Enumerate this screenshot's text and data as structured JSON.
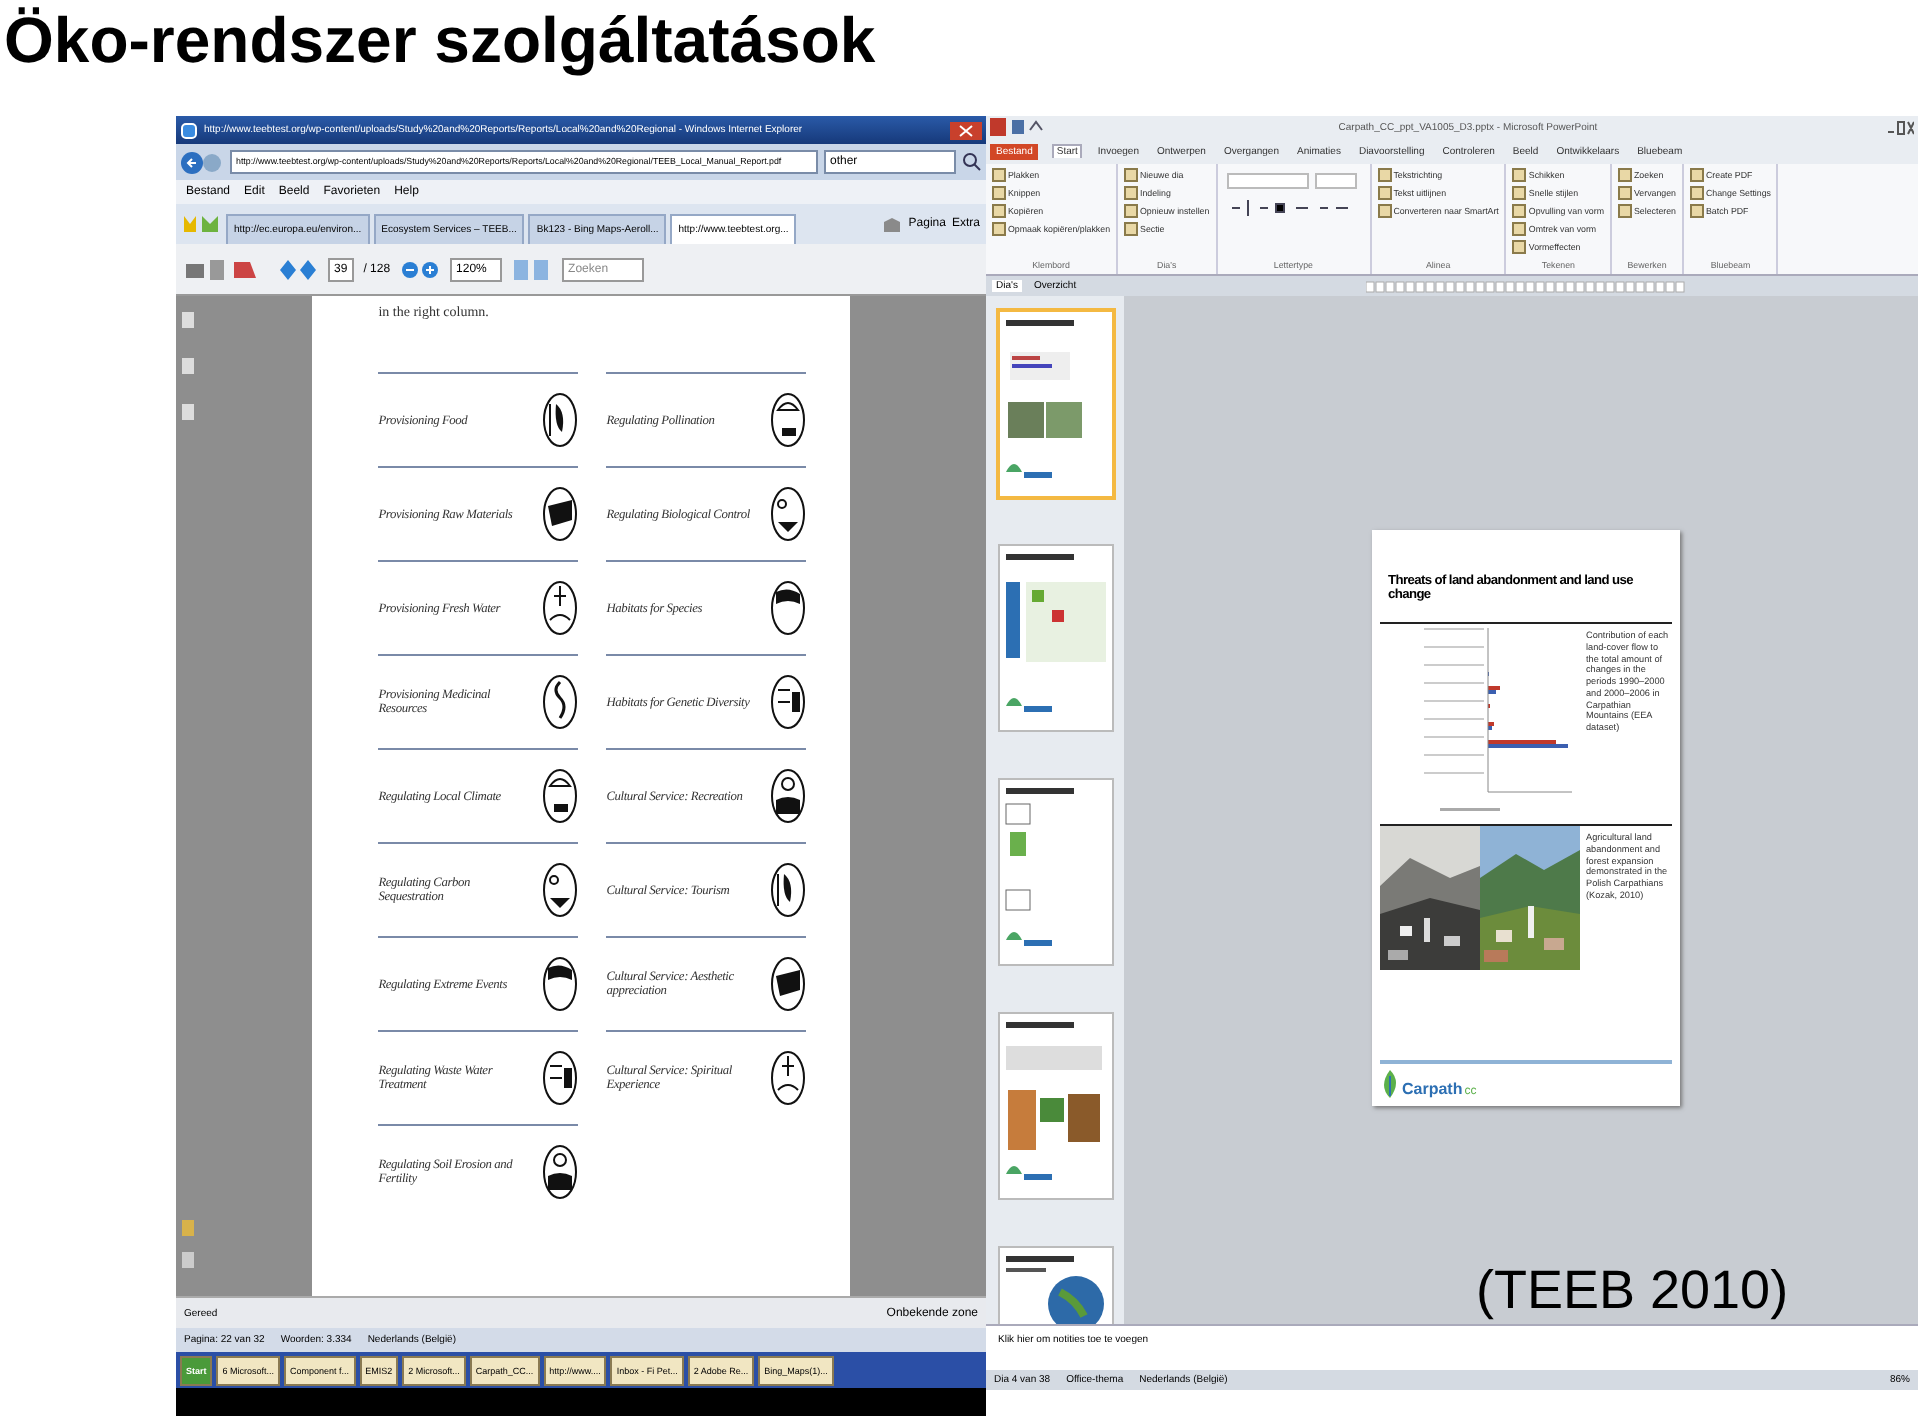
{
  "slide": {
    "title": "Öko-rendszer szolgáltatások",
    "caption": "(TEEB 2010)"
  },
  "browser": {
    "title": "http://www.teebtest.org/wp-content/uploads/Study%20and%20Reports/Reports/Local%20and%20Regional - Windows Internet Explorer",
    "address": "http://www.teebtest.org/wp-content/uploads/Study%20and%20Reports/Reports/Local%20and%20Regional/TEEB_Local_Manual_Report.pdf",
    "search": "other",
    "menu": [
      "Bestand",
      "Edit",
      "Beeld",
      "Favorieten",
      "Help"
    ],
    "tabs": [
      {
        "label": "http://ec.europa.eu/environ...",
        "selected": false
      },
      {
        "label": "Ecosystem Services – TEEB...",
        "selected": false
      },
      {
        "label": "Bk123 - Bing Maps-Aeroll...",
        "selected": false
      },
      {
        "label": "http://www.teebtest.org...",
        "selected": true
      }
    ],
    "toolbar_right": [
      "Pagina",
      "Extra"
    ],
    "page_number": "39",
    "page_count": "/ 128",
    "zoom": "120%",
    "find": "Zoeken",
    "document": {
      "intro": "in the right column.",
      "left": [
        "Provisioning Food",
        "Provisioning Raw Materials",
        "Provisioning Fresh Water",
        "Provisioning Medicinal Resources",
        "Regulating Local Climate",
        "Regulating Carbon Sequestration",
        "Regulating Extreme Events",
        "Regulating Waste Water Treatment",
        "Regulating Soil Erosion and Fertility"
      ],
      "right": [
        "Regulating Pollination",
        "Regulating Biological Control",
        "Habitats for Species",
        "Habitats for Genetic Diversity",
        "Cultural Service: Recreation",
        "Cultural Service: Tourism",
        "Cultural Service: Aesthetic appreciation",
        "Cultural Service: Spiritual Experience"
      ]
    },
    "status": "Gereed",
    "zone": "Onbekende zone",
    "word_status": [
      "Pagina: 22 van 32",
      "Woorden: 3.334",
      "Nederlands (België)"
    ],
    "taskbar": [
      "Start",
      "6 Microsoft...",
      "Component f...",
      "EMIS2",
      "2 Microsoft...",
      "Carpath_CC...",
      "http://www....",
      "Inbox - Fi Pet...",
      "2 Adobe Re...",
      "Bing_Maps(1)..."
    ]
  },
  "powerpoint": {
    "title": "Carpath_CC_ppt_VA1005_D3.pptx - Microsoft PowerPoint",
    "tabs": [
      {
        "label": "Bestand",
        "kind": "file",
        "selected": false
      },
      {
        "label": "Start",
        "kind": "tab",
        "selected": true
      },
      {
        "label": "Invoegen",
        "kind": "tab",
        "selected": false
      },
      {
        "label": "Ontwerpen",
        "kind": "tab",
        "selected": false
      },
      {
        "label": "Overgangen",
        "kind": "tab",
        "selected": false
      },
      {
        "label": "Animaties",
        "kind": "tab",
        "selected": false
      },
      {
        "label": "Diavoorstelling",
        "kind": "tab",
        "selected": false
      },
      {
        "label": "Controleren",
        "kind": "tab",
        "selected": false
      },
      {
        "label": "Beeld",
        "kind": "tab",
        "selected": false
      },
      {
        "label": "Ontwikkelaars",
        "kind": "tab",
        "selected": false
      },
      {
        "label": "Bluebeam",
        "kind": "tab",
        "selected": false
      }
    ],
    "groups": [
      {
        "label": "Klembord",
        "buttons": [
          "Plakken",
          "Knippen",
          "Kopiëren",
          "Opmaak kopiëren/plakken"
        ]
      },
      {
        "label": "Dia's",
        "buttons": [
          "Nieuwe dia",
          "Indeling",
          "Opnieuw instellen",
          "Sectie"
        ]
      },
      {
        "label": "Lettertype"
      },
      {
        "label": "Alinea",
        "buttons": [
          "Tekstrichting",
          "Tekst uitlijnen",
          "Converteren naar SmartArt"
        ]
      },
      {
        "label": "Tekenen",
        "buttons": [
          "Schikken",
          "Snelle stijlen",
          "Opvulling van vorm",
          "Omtrek van vorm",
          "Vormeffecten"
        ]
      },
      {
        "label": "Bewerken",
        "buttons": [
          "Zoeken",
          "Vervangen",
          "Selecteren"
        ]
      },
      {
        "label": "Bluebeam",
        "buttons": [
          "Create PDF",
          "Change Settings",
          "Batch PDF"
        ]
      }
    ],
    "panel_tabs": [
      {
        "label": "Dia's",
        "selected": true
      },
      {
        "label": "Overzicht",
        "selected": false
      }
    ],
    "thumbnails": [
      {
        "selected": true
      },
      {
        "selected": false
      },
      {
        "selected": false
      },
      {
        "selected": false
      },
      {
        "selected": false
      }
    ],
    "slide": {
      "title": "Threats of land abandonment and land use change",
      "text_1": "Contribution of each land-cover flow to the total amount of changes in the periods 1990–2000 and 2000–2006 in Carpathian Mountains (EEA dataset)",
      "text_2": "Agricultural land abandonment and forest expansion demonstrated in the Polish Carpathians (Kozak, 2010)",
      "logo": "Carpath",
      "logo_suffix": "cc"
    },
    "notes_placeholder": "Klik hier om notities toe te voegen",
    "status": [
      "Dia 4 van 38",
      "Office-thema",
      "Nederlands (België)"
    ],
    "zoom": "86%"
  }
}
